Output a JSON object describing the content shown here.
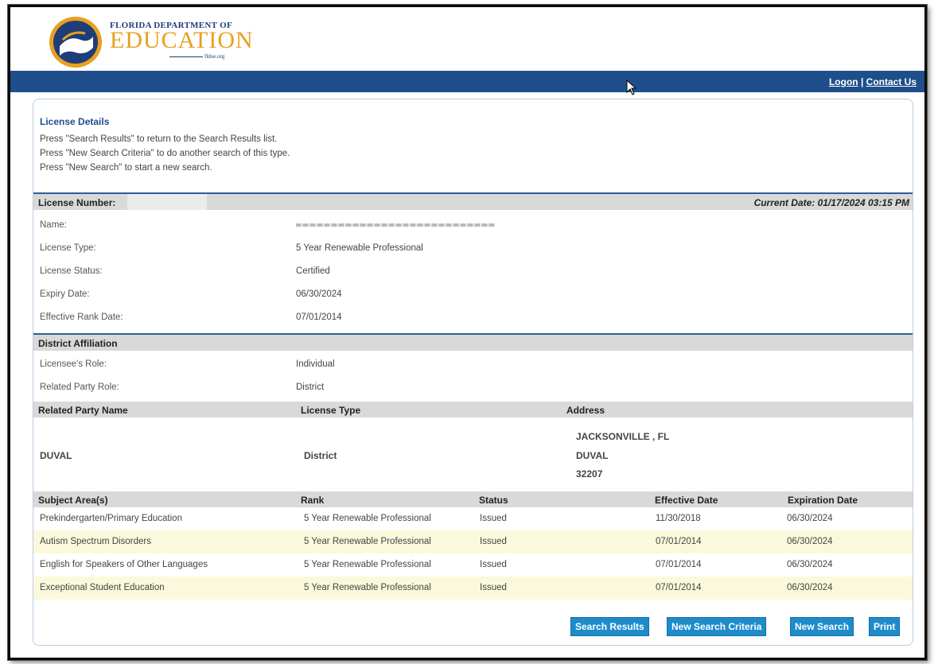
{
  "header": {
    "org_top": "FLORIDA DEPARTMENT OF",
    "org_main": "EDUCATION",
    "org_url": "fldoe.org"
  },
  "nav": {
    "logon": "Logon",
    "separator": "|",
    "contact": "Contact Us"
  },
  "intro": {
    "title": "License Details",
    "lines": [
      "Press \"Search Results\" to return to the Search Results list.",
      "Press \"New Search Criteria\" to do another search of this type.",
      "Press \"New Search\" to start a new search."
    ]
  },
  "license": {
    "number_label": "License Number:",
    "current_date": "Current Date: 01/17/2024 03:15 PM",
    "fields": [
      {
        "label": "Name:",
        "value": ""
      },
      {
        "label": "License Type:",
        "value": "5 Year Renewable Professional"
      },
      {
        "label": "License Status:",
        "value": "Certified"
      },
      {
        "label": "Expiry Date:",
        "value": "06/30/2024"
      },
      {
        "label": "Effective Rank Date:",
        "value": "07/01/2014"
      }
    ]
  },
  "district": {
    "heading": "District Affiliation",
    "fields": [
      {
        "label": "Licensee's Role:",
        "value": "Individual"
      },
      {
        "label": "Related Party Role:",
        "value": "District"
      }
    ],
    "columns": [
      "Related Party Name",
      "License Type",
      "Address"
    ],
    "party_name": "DUVAL",
    "party_type": "District",
    "address": [
      "JACKSONVILLE , FL",
      "DUVAL",
      "32207"
    ]
  },
  "subjects": {
    "columns": [
      "Subject Area(s)",
      "Rank",
      "Status",
      "Effective Date",
      "Expiration Date"
    ],
    "rows": [
      [
        "Prekindergarten/Primary Education",
        "5 Year Renewable Professional",
        "Issued",
        "11/30/2018",
        "06/30/2024"
      ],
      [
        "Autism Spectrum Disorders",
        "5 Year Renewable Professional",
        "Issued",
        "07/01/2014",
        "06/30/2024"
      ],
      [
        "English for Speakers of Other Languages",
        "5 Year Renewable Professional",
        "Issued",
        "07/01/2014",
        "06/30/2024"
      ],
      [
        "Exceptional Student Education",
        "5 Year Renewable Professional",
        "Issued",
        "07/01/2014",
        "06/30/2024"
      ]
    ]
  },
  "buttons": {
    "search_results": "Search Results",
    "new_search_criteria": "New Search Criteria",
    "new_search": "New Search",
    "print": "Print"
  },
  "colors": {
    "brand_blue": "#1e4f8a",
    "button_blue": "#1e8ccb",
    "logo_gold": "#e8a021",
    "row_alt": "#fbf9dc"
  }
}
